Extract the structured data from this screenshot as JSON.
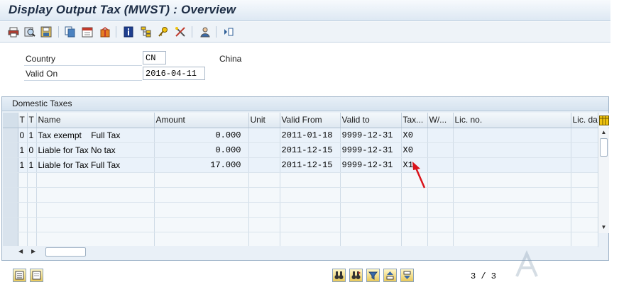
{
  "window": {
    "title": "Display Output Tax (MWST) : Overview"
  },
  "toolbar": {
    "icons": [
      "print-icon",
      "find-icon",
      "save-icon",
      "copy-icon",
      "calendar-icon",
      "gift-icon",
      "info-icon",
      "structure-icon",
      "key-icon",
      "tools-icon",
      "person-icon",
      "expand-icon"
    ]
  },
  "header": {
    "country_label": "Country",
    "country_value": "CN",
    "country_text": "China",
    "valid_on_label": "Valid On",
    "valid_on_value": "2016-04-11"
  },
  "domestic": {
    "title": "Domestic Taxes",
    "columns": [
      "",
      "T",
      "T",
      "Name",
      "Amount",
      "Unit",
      "Valid From",
      "Valid to",
      "Tax...",
      "W/...",
      "Lic. no.",
      "Lic. da"
    ],
    "rows": [
      {
        "t1": "0",
        "t2": "1",
        "name": "Tax exempt    Full Tax",
        "amount": "0.000",
        "unit": "",
        "valid_from": "2011-01-18",
        "valid_to": "9999-12-31",
        "tax": "X0",
        "w": "",
        "lic_no": "",
        "lic_da": ""
      },
      {
        "t1": "1",
        "t2": "0",
        "name": "Liable for Tax No tax",
        "amount": "0.000",
        "unit": "",
        "valid_from": "2011-12-15",
        "valid_to": "9999-12-31",
        "tax": "X0",
        "w": "",
        "lic_no": "",
        "lic_da": ""
      },
      {
        "t1": "1",
        "t2": "1",
        "name": "Liable for Tax Full Tax",
        "amount": "17.000",
        "unit": "",
        "valid_from": "2011-12-15",
        "valid_to": "9999-12-31",
        "tax": "X1",
        "w": "",
        "lic_no": "",
        "lic_da": ""
      }
    ],
    "empty_rows": 5
  },
  "footer": {
    "pager": "3 / 3"
  },
  "colors": {
    "title_text": "#1c2c44",
    "row_bg": "#eaf2fa",
    "annotation_arrow": "#d9141b"
  }
}
